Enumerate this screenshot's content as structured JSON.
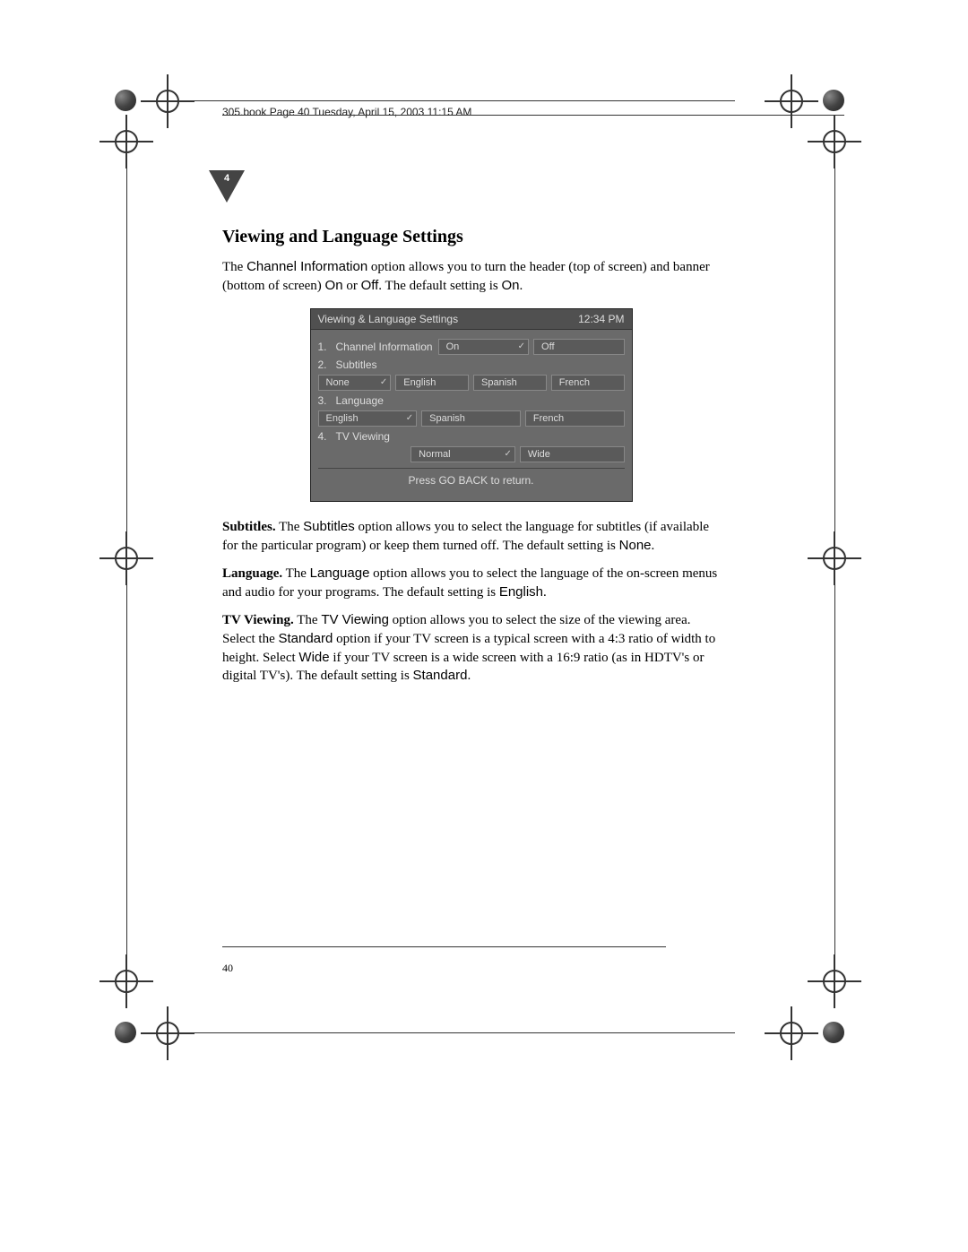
{
  "header": "305.book  Page 40  Tuesday, April 15, 2003  11:15 AM",
  "chapter_num": "4",
  "section_title": "Viewing and Language Settings",
  "para1": {
    "pre": "The ",
    "term1": "Channel Information",
    "mid1": " option allows you to turn the header (top of screen) and banner (bottom of screen) ",
    "on": "On",
    "or": " or ",
    "off": "Off",
    "mid2": ".  The default setting is ",
    "def": "On",
    "end": "."
  },
  "screenshot": {
    "title": "Viewing & Language Settings",
    "time": "12:34 PM",
    "row1": {
      "num": "1.",
      "label": "Channel Information",
      "o1": "On",
      "o2": "Off"
    },
    "row2": {
      "num": "2.",
      "label": "Subtitles"
    },
    "row2opts": {
      "o1": "None",
      "o2": "English",
      "o3": "Spanish",
      "o4": "French"
    },
    "row3": {
      "num": "3.",
      "label": "Language"
    },
    "row3opts": {
      "o1": "English",
      "o2": "Spanish",
      "o3": "French"
    },
    "row4": {
      "num": "4.",
      "label": "TV Viewing"
    },
    "row4opts": {
      "o1": "Normal",
      "o2": "Wide"
    },
    "footer": "Press GO BACK to return."
  },
  "para2": {
    "head": "Subtitles.",
    "pre": " The ",
    "term": "Subtitles",
    "body": " option allows you to select the language for subtitles (if available for the particular program) or keep them turned off. The default setting is ",
    "def": "None",
    "end": "."
  },
  "para3": {
    "head": "Language.",
    "pre": " The ",
    "term": "Language",
    "body": " option allows you to select the language of the on-screen menus and audio for your programs. The default setting is ",
    "def": "English",
    "end": "."
  },
  "para4": {
    "head": "TV Viewing.",
    "pre": " The ",
    "term": "TV Viewing",
    "body1": " option allows you to select the size of the viewing area. Select the ",
    "std": "Standard",
    "body2": " option if your TV screen is a typical screen with a 4:3 ratio of width to height. Select ",
    "wide": "Wide",
    "body3": " if your TV screen is a wide screen with a 16:9 ratio (as in HDTV's or digital TV's). The default setting is ",
    "def": "Standard",
    "end": "."
  },
  "page_number": "40"
}
